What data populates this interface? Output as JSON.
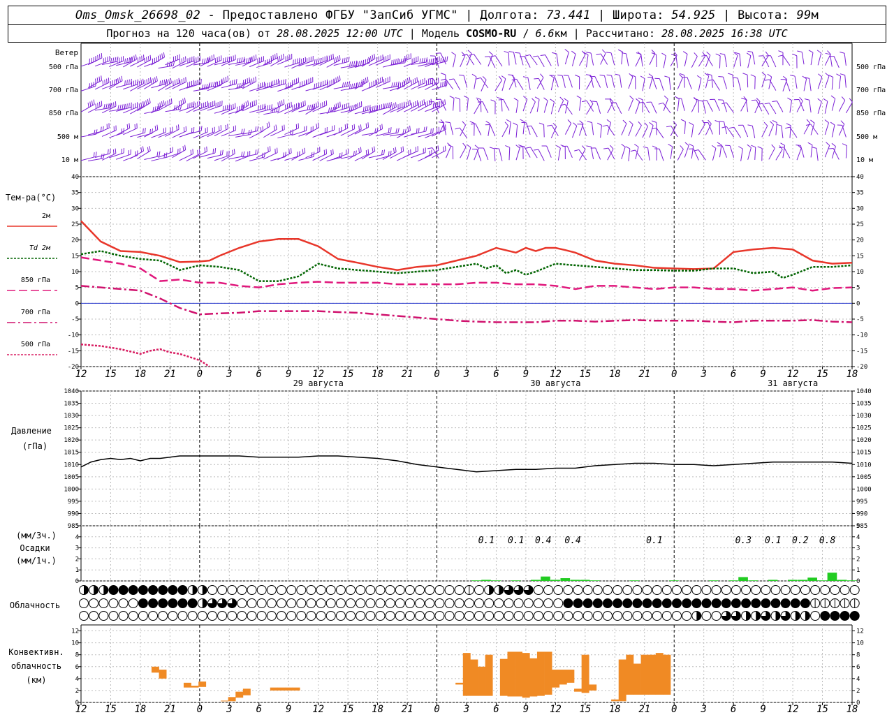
{
  "header": {
    "station": "Oms_Omsk_26698_02",
    "sep1": " - ",
    "provided_by": "Предоставлено ФГБУ \"ЗапСиб УГМС\"",
    "lon_label": "Долгота:",
    "lon_value": "73.441",
    "lat_label": "Широта:",
    "lat_value": "54.925",
    "alt_label": "Высота:",
    "alt_value": "99",
    "alt_unit": "м",
    "forecast_label": "Прогноз на 120 часа(ов) от",
    "forecast_time": "28.08.2025 12:00 UTC",
    "model_label": "Модель",
    "model_name": "COSMO-RU",
    "model_sep": " / ",
    "model_res": "6.6",
    "model_res_unit": "км",
    "calc_label": "Рассчитано:",
    "calc_time": "28.08.2025 16:38 UTC"
  },
  "colors": {
    "wind": "#7b1fd6",
    "t2m": "#e8362a",
    "td2m": "#006400",
    "t850": "#e0187c",
    "t700": "#d0126e",
    "t500": "#d81b60",
    "zero": "#2233cc",
    "pressure": "#000000",
    "precip": "#22cc22",
    "conv": "#f08a24"
  },
  "time_axis": {
    "ticks": [
      "12",
      "15",
      "18",
      "21",
      "0",
      "3",
      "6",
      "9",
      "12",
      "15",
      "18",
      "21",
      "0",
      "3",
      "6",
      "9",
      "12",
      "15",
      "18",
      "21",
      "0",
      "3",
      "6",
      "9",
      "12",
      "15",
      "18"
    ],
    "day_labels": [
      {
        "label": "29 августа",
        "tick_index": 8
      },
      {
        "label": "30 августа",
        "tick_index": 16
      },
      {
        "label": "31 августа",
        "tick_index": 24
      }
    ]
  },
  "chart_data": [
    {
      "type": "wind_barbs",
      "title": "Ветер",
      "levels": [
        "500 гПа",
        "700 гПа",
        "850 гПа",
        "500 м",
        "10 м"
      ],
      "panel_label": "Ветер"
    },
    {
      "type": "line",
      "title": "Тем-ра(°C)",
      "ylim": [
        -20,
        40
      ],
      "yticks": [
        -20,
        -15,
        -10,
        -5,
        0,
        5,
        10,
        15,
        20,
        25,
        30,
        35,
        40
      ],
      "x_hours": [
        0,
        1,
        2,
        3,
        4,
        5,
        6,
        7,
        8,
        9,
        10,
        11,
        12,
        13,
        14,
        15,
        16,
        17,
        18,
        19,
        20,
        21,
        22,
        23,
        24,
        25,
        26,
        27,
        28,
        29,
        30,
        31,
        32,
        33,
        34,
        35,
        36,
        37,
        38,
        39,
        40,
        41,
        42,
        43,
        44,
        45,
        46,
        47,
        48,
        49,
        50,
        51,
        52,
        53,
        54,
        55,
        56,
        57,
        58,
        59,
        60,
        61,
        62,
        63,
        64,
        65,
        66,
        67,
        68,
        69,
        70,
        71,
        72,
        73,
        74,
        75,
        76,
        77,
        78
      ],
      "series": [
        {
          "name": "2м",
          "legend": "2м",
          "style": "solid",
          "x": [
            0,
            2,
            4,
            6,
            8,
            10,
            12,
            13,
            14,
            16,
            18,
            20,
            22,
            24,
            26,
            28,
            30,
            32,
            34,
            36,
            38,
            40,
            42,
            44,
            45,
            46,
            47,
            48,
            49,
            50,
            52,
            54,
            56,
            58,
            60,
            62,
            64,
            66,
            68,
            70,
            72,
            74,
            76,
            78
          ],
          "values": [
            26,
            19.5,
            16.5,
            16.2,
            15,
            13,
            13.2,
            13.5,
            15,
            17.5,
            19.5,
            20.3,
            20.3,
            18,
            14,
            12.8,
            11.5,
            10.5,
            11.5,
            12,
            13.5,
            15,
            17.5,
            16,
            17.5,
            16.5,
            17.5,
            17.5,
            16.8,
            16,
            13.5,
            12.5,
            12,
            11.2,
            11,
            10.8,
            11,
            16.2,
            17,
            17.5,
            17,
            13.5,
            12.5,
            12.8
          ]
        },
        {
          "name": "Td 2м",
          "legend": "Td 2м",
          "style": "dotted",
          "x": [
            0,
            2,
            4,
            6,
            8,
            10,
            12,
            14,
            16,
            18,
            20,
            22,
            24,
            26,
            28,
            30,
            32,
            34,
            36,
            38,
            40,
            41,
            42,
            43,
            44,
            45,
            46,
            48,
            50,
            52,
            54,
            56,
            58,
            60,
            62,
            64,
            66,
            68,
            70,
            71,
            72,
            74,
            76,
            78
          ],
          "values": [
            15.5,
            16.5,
            15,
            14,
            13.5,
            10.5,
            12,
            11.5,
            10.5,
            7,
            7,
            8.5,
            12.5,
            11,
            10.5,
            10,
            9.5,
            10,
            10.5,
            11.5,
            12.5,
            11,
            12,
            9.5,
            10.5,
            9,
            10,
            12.5,
            12,
            11.5,
            11,
            10.5,
            10.5,
            10.3,
            10.3,
            11,
            11,
            9.5,
            10,
            8,
            9,
            11.5,
            11.5,
            12
          ]
        },
        {
          "name": "850 гПа",
          "legend": "850 гПа",
          "style": "dash",
          "x": [
            0,
            2,
            4,
            6,
            8,
            10,
            12,
            14,
            16,
            18,
            20,
            22,
            24,
            26,
            28,
            30,
            32,
            34,
            36,
            38,
            40,
            42,
            44,
            46,
            48,
            50,
            52,
            54,
            56,
            58,
            60,
            62,
            64,
            66,
            68,
            70,
            72,
            74,
            76,
            78
          ],
          "values": [
            14.5,
            13.5,
            12.5,
            11,
            7,
            7.5,
            6.5,
            6.5,
            5.5,
            5,
            6,
            6.5,
            6.8,
            6.5,
            6.5,
            6.5,
            6,
            6,
            6,
            6,
            6.5,
            6.5,
            6,
            6,
            5.5,
            4.5,
            5.5,
            5.5,
            5,
            4.5,
            5,
            5,
            4.5,
            4.5,
            4,
            4.5,
            5,
            4,
            4.8,
            5
          ]
        },
        {
          "name": "700 гПа",
          "legend": "700 гПа",
          "style": "dashdot",
          "x": [
            0,
            2,
            4,
            6,
            8,
            10,
            12,
            14,
            16,
            18,
            20,
            22,
            24,
            26,
            28,
            30,
            32,
            34,
            36,
            38,
            40,
            42,
            44,
            46,
            48,
            50,
            52,
            54,
            56,
            58,
            60,
            62,
            64,
            66,
            68,
            70,
            72,
            74,
            76,
            78
          ],
          "values": [
            5.5,
            5,
            4.5,
            4,
            1.5,
            -1.5,
            -3.5,
            -3.2,
            -3,
            -2.5,
            -2.5,
            -2.5,
            -2.5,
            -2.8,
            -3,
            -3.5,
            -4,
            -4.5,
            -5,
            -5.5,
            -5.8,
            -6,
            -6,
            -6,
            -5.5,
            -5.5,
            -5.8,
            -5.5,
            -5.3,
            -5.5,
            -5.5,
            -5.5,
            -5.8,
            -6,
            -5.5,
            -5.5,
            -5.5,
            -5.3,
            -5.8,
            -6
          ]
        },
        {
          "name": "500 гПа",
          "legend": "500 гПа",
          "style": "dotted",
          "x": [
            0,
            2,
            4,
            6,
            7,
            8,
            9,
            10,
            11,
            12,
            13
          ],
          "values": [
            -13,
            -13.5,
            -14.5,
            -16,
            -15,
            -14.5,
            -15.5,
            -16,
            -17,
            -18,
            -20
          ]
        }
      ]
    },
    {
      "type": "line",
      "title": "Давление",
      "ylabel": "(гПа)",
      "ylim": [
        985,
        1040
      ],
      "yticks": [
        985,
        990,
        995,
        1000,
        1005,
        1010,
        1015,
        1020,
        1025,
        1030,
        1035,
        1040
      ],
      "x": [
        0,
        1,
        2,
        3,
        4,
        5,
        6,
        7,
        8,
        9,
        10,
        11,
        12,
        14,
        16,
        18,
        20,
        22,
        24,
        26,
        28,
        30,
        32,
        34,
        36,
        38,
        40,
        42,
        44,
        46,
        48,
        50,
        52,
        54,
        56,
        58,
        60,
        62,
        64,
        66,
        68,
        70,
        72,
        74,
        76,
        78
      ],
      "values": [
        1009,
        1011,
        1012,
        1012.5,
        1012,
        1012.5,
        1011.5,
        1012.5,
        1012.5,
        1013,
        1013.5,
        1013.5,
        1013.5,
        1013.5,
        1013.5,
        1013,
        1013,
        1013,
        1013.5,
        1013.5,
        1013,
        1012.5,
        1011.5,
        1010,
        1009,
        1008,
        1007,
        1007.5,
        1008,
        1008,
        1008.5,
        1008.5,
        1009.5,
        1010,
        1010.5,
        1010.5,
        1010,
        1010,
        1009.5,
        1010,
        1010.5,
        1011,
        1011,
        1011,
        1011,
        1010.5
      ]
    },
    {
      "type": "bar",
      "title": "Осадки",
      "ylabel": "(мм/3ч.)",
      "ylabel2": "(мм/1ч.)",
      "ylim": [
        0,
        5
      ],
      "yticks": [
        0,
        1,
        2,
        3,
        4,
        5
      ],
      "x": [
        40,
        41,
        42,
        44,
        46,
        47,
        48,
        49,
        50,
        51,
        52,
        56,
        60,
        64,
        66,
        67,
        68,
        70,
        72,
        73,
        74,
        75,
        76,
        77,
        78
      ],
      "values": [
        0.05,
        0.1,
        0.05,
        0.05,
        0.1,
        0.4,
        0.1,
        0.25,
        0.1,
        0.1,
        0.05,
        0.05,
        0.05,
        0.05,
        0.05,
        0.35,
        0.05,
        0.1,
        0.1,
        0.1,
        0.3,
        0.05,
        0.75,
        0.1,
        0.05
      ],
      "labels": [
        {
          "x": 41,
          "text": "0.1"
        },
        {
          "x": 44,
          "text": "0.1"
        },
        {
          "x": 46.75,
          "text": "0.4"
        },
        {
          "x": 49.75,
          "text": "0.4"
        },
        {
          "x": 58,
          "text": "0.1"
        },
        {
          "x": 67,
          "text": "0.3"
        },
        {
          "x": 70,
          "text": "0.1"
        },
        {
          "x": 72.75,
          "text": "0.2"
        },
        {
          "x": 75.5,
          "text": "0.8"
        }
      ]
    },
    {
      "type": "table",
      "title": "Облачность",
      "rows": [
        "HHHFFFFFFFFHHAAAAAAAAAAAAAAAAAAAAAAAAAABAHHDDDAAAAAAAAAAAAAAAAAAAAAAAAAAAAAAAAAAAAAAAAAAAAAAAHAAAA",
        "AAAAAAFFFFFFHDDDAAAAAAAAAAAAAAAAAAAAAAAAAAAAAAAAAFFFFFFFFFFFFFFFFFFFFFFFFFBBBBBBBBBBBBBBBBBBBB",
        "AAAAAAAAAAAAAAAAAAAAAAAAAAAAAAAAAAAAAAAAAAAAAAAAAAAAAAAAAAAAAAHAADDHHDHDHHAFFFFFAAHHHAAAHAAAHH"
      ]
    },
    {
      "type": "bar",
      "title": "Конвективн.",
      "ylabel": "облачность",
      "ylabel2": "(км)",
      "ylim": [
        0,
        13
      ],
      "yticks": [
        0,
        2,
        4,
        6,
        8,
        10,
        12
      ],
      "bars": [
        {
          "x": 7.5,
          "bottom": 5,
          "top": 6
        },
        {
          "x": 8.25,
          "bottom": 4,
          "top": 5.5
        },
        {
          "x": 10.75,
          "bottom": 2.5,
          "top": 3.3
        },
        {
          "x": 11.5,
          "bottom": 2.5,
          "top": 2.8
        },
        {
          "x": 12.25,
          "bottom": 2.6,
          "top": 3.5
        },
        {
          "x": 14.5,
          "bottom": 0.2,
          "top": 0.3
        },
        {
          "x": 15.25,
          "bottom": 0.2,
          "top": 0.9
        },
        {
          "x": 16,
          "bottom": 0.8,
          "top": 1.8
        },
        {
          "x": 16.75,
          "bottom": 1.2,
          "top": 2.3
        },
        {
          "x": 19.5,
          "bottom": 2,
          "top": 2.5
        },
        {
          "x": 20.25,
          "bottom": 2,
          "top": 2.5
        },
        {
          "x": 21,
          "bottom": 2,
          "top": 2.5
        },
        {
          "x": 21.75,
          "bottom": 2,
          "top": 2.5
        },
        {
          "x": 38.25,
          "bottom": 3,
          "top": 3.3
        },
        {
          "x": 39,
          "bottom": 1.1,
          "top": 8.3
        },
        {
          "x": 39.75,
          "bottom": 1.1,
          "top": 7.2
        },
        {
          "x": 40.5,
          "bottom": 1.1,
          "top": 6
        },
        {
          "x": 41.25,
          "bottom": 1.1,
          "top": 8
        },
        {
          "x": 42.75,
          "bottom": 1.1,
          "top": 7.3
        },
        {
          "x": 43.5,
          "bottom": 1,
          "top": 8.5
        },
        {
          "x": 44.25,
          "bottom": 1,
          "top": 8.5
        },
        {
          "x": 45,
          "bottom": 0.8,
          "top": 8.3
        },
        {
          "x": 45.75,
          "bottom": 1,
          "top": 7.4
        },
        {
          "x": 46.5,
          "bottom": 1.1,
          "top": 8.5
        },
        {
          "x": 47.25,
          "bottom": 1.3,
          "top": 8.5
        },
        {
          "x": 48,
          "bottom": 2.5,
          "top": 5.5
        },
        {
          "x": 48.75,
          "bottom": 3,
          "top": 5.5
        },
        {
          "x": 49.5,
          "bottom": 3.3,
          "top": 5.5
        },
        {
          "x": 50.25,
          "bottom": 1.8,
          "top": 2.3
        },
        {
          "x": 51,
          "bottom": 1.6,
          "top": 8
        },
        {
          "x": 51.75,
          "bottom": 2,
          "top": 3
        },
        {
          "x": 54,
          "bottom": 0.2,
          "top": 0.5
        },
        {
          "x": 54.75,
          "bottom": 0.2,
          "top": 7.2
        },
        {
          "x": 55.5,
          "bottom": 1.3,
          "top": 8
        },
        {
          "x": 56.25,
          "bottom": 1.3,
          "top": 6.5
        },
        {
          "x": 57,
          "bottom": 1.3,
          "top": 8
        },
        {
          "x": 57.75,
          "bottom": 1.3,
          "top": 8
        },
        {
          "x": 58.5,
          "bottom": 1.3,
          "top": 8.3
        },
        {
          "x": 59.25,
          "bottom": 1.3,
          "top": 8
        }
      ]
    }
  ]
}
